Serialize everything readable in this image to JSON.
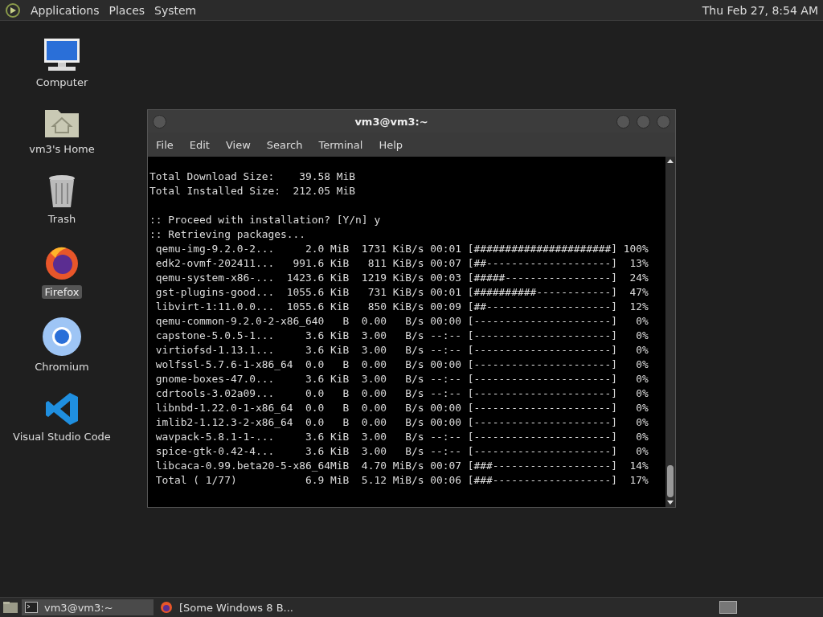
{
  "top_panel": {
    "menus": [
      "Applications",
      "Places",
      "System"
    ],
    "clock": "Thu Feb 27,  8:54 AM"
  },
  "desktop_icons": [
    {
      "label": "Computer",
      "kind": "computer",
      "selected": false
    },
    {
      "label": "vm3's Home",
      "kind": "home",
      "selected": false
    },
    {
      "label": "Trash",
      "kind": "trash",
      "selected": false
    },
    {
      "label": "Firefox",
      "kind": "firefox",
      "selected": true
    },
    {
      "label": "Chromium",
      "kind": "chromium",
      "selected": false
    },
    {
      "label": "Visual Studio Code",
      "kind": "vscode",
      "selected": false
    }
  ],
  "terminal": {
    "title": "vm3@vm3:~",
    "menu": [
      "File",
      "Edit",
      "View",
      "Search",
      "Terminal",
      "Help"
    ],
    "blocks": [
      [
        "Total Download Size:    39.58 MiB",
        "Total Installed Size:  212.05 MiB"
      ],
      [
        ":: Proceed with installation? [Y/n] y",
        ":: Retrieving packages...",
        " qemu-img-9.2.0-2...     2.0 MiB  1731 KiB/s 00:01 [######################] 100%",
        " edk2-ovmf-202411...   991.6 KiB   811 KiB/s 00:07 [##--------------------]  13%",
        " qemu-system-x86-...  1423.6 KiB  1219 KiB/s 00:03 [#####-----------------]  24%",
        " gst-plugins-good...  1055.6 KiB   731 KiB/s 00:01 [##########------------]  47%",
        " libvirt-1:11.0.0...  1055.6 KiB   850 KiB/s 00:09 [##--------------------]  12%",
        " qemu-common-9.2.0-2-x86_640   B  0.00   B/s 00:00 [----------------------]   0%",
        " capstone-5.0.5-1...     3.6 KiB  3.00   B/s --:-- [----------------------]   0%",
        " virtiofsd-1.13.1...     3.6 KiB  3.00   B/s --:-- [----------------------]   0%",
        " wolfssl-5.7.6-1-x86_64  0.0   B  0.00   B/s 00:00 [----------------------]   0%",
        " gnome-boxes-47.0...     3.6 KiB  3.00   B/s --:-- [----------------------]   0%",
        " cdrtools-3.02a09...     0.0   B  0.00   B/s --:-- [----------------------]   0%",
        " libnbd-1.22.0-1-x86_64  0.0   B  0.00   B/s 00:00 [----------------------]   0%",
        " imlib2-1.12.3-2-x86_64  0.0   B  0.00   B/s 00:00 [----------------------]   0%",
        " wavpack-5.8.1-1-...     3.6 KiB  3.00   B/s --:-- [----------------------]   0%",
        " spice-gtk-0.42-4...     3.6 KiB  3.00   B/s --:-- [----------------------]   0%",
        " libcaca-0.99.beta20-5-x86_64MiB  4.70 MiB/s 00:07 [###-------------------]  14%",
        " Total ( 1/77)           6.9 MiB  5.12 MiB/s 00:06 [###-------------------]  17%"
      ]
    ]
  },
  "taskbar": {
    "tasks": [
      {
        "label": "vm3@vm3:~",
        "kind": "terminal",
        "selected": true
      },
      {
        "label": "[Some Windows 8 B...",
        "kind": "firefox",
        "selected": false
      }
    ]
  }
}
